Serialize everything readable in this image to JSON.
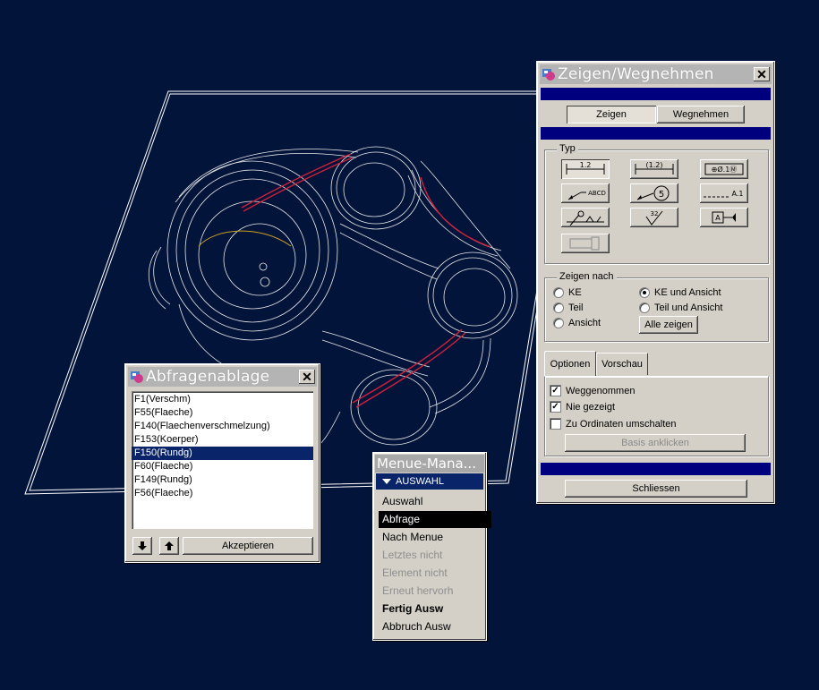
{
  "zeigen_dialog": {
    "title": "Zeigen/Wegnehmen",
    "tab_zeigen": "Zeigen",
    "tab_wegnehmen": "Wegnehmen",
    "typ_label": "Typ",
    "symbols": {
      "dim1": "1.2",
      "dim2": "(1.2)",
      "gtol": "⊕Ø.1Ⓜ",
      "note": "ABCD",
      "balloon": "5",
      "datum_axis": "A.1",
      "datum_target": "A",
      "surface_finish": "32"
    },
    "zeigen_nach_label": "Zeigen nach",
    "radios": [
      {
        "label": "KE",
        "checked": false
      },
      {
        "label": "KE und Ansicht",
        "checked": true
      },
      {
        "label": "Teil",
        "checked": false
      },
      {
        "label": "Teil und Ansicht",
        "checked": false
      },
      {
        "label": "Ansicht",
        "checked": false
      }
    ],
    "alle_zeigen": "Alle zeigen",
    "tab_optionen": "Optionen",
    "tab_vorschau": "Vorschau",
    "checks": [
      {
        "label": "Weggenommen",
        "checked": true
      },
      {
        "label": "Nie gezeigt",
        "checked": true
      },
      {
        "label": "Zu Ordinaten umschalten",
        "checked": false
      }
    ],
    "basis_anklicken": "Basis anklicken",
    "schliessen": "Schliessen"
  },
  "abfragen_dialog": {
    "title": "Abfragenablage",
    "items": [
      {
        "label": "F1(Verschm)",
        "selected": false
      },
      {
        "label": "F55(Flaeche)",
        "selected": false
      },
      {
        "label": "F140(Flaechenverschmelzung)",
        "selected": false
      },
      {
        "label": "F153(Koerper)",
        "selected": false
      },
      {
        "label": "F150(Rundg)",
        "selected": true
      },
      {
        "label": "F60(Flaeche)",
        "selected": false
      },
      {
        "label": "F149(Rundg)",
        "selected": false
      },
      {
        "label": "F56(Flaeche)",
        "selected": false
      }
    ],
    "down_icon": "arrow-down-icon",
    "up_icon": "arrow-up-icon",
    "akzeptieren": "Akzeptieren"
  },
  "menu_manager": {
    "title": "Menue-Mana...",
    "header": "AUSWAHL",
    "items": [
      {
        "label": "Auswahl",
        "state": "normal"
      },
      {
        "label": "Abfrage",
        "state": "selected"
      },
      {
        "label": "Nach Menue",
        "state": "normal"
      },
      {
        "label": "Letztes nicht",
        "state": "disabled"
      },
      {
        "label": "Element nicht",
        "state": "disabled"
      },
      {
        "label": "Erneut hervorh",
        "state": "disabled"
      },
      {
        "label": "Fertig Ausw",
        "state": "bold"
      },
      {
        "label": "Abbruch Ausw",
        "state": "normal"
      }
    ]
  },
  "colors": {
    "background": "#02143a",
    "dialog": "#d4d0c8",
    "title_bar": "#b4b4b4",
    "accent_bar": "#00007f",
    "selection": "#0a246a",
    "highlight_edge": "#d0203a",
    "wireframe": "#ffffff"
  }
}
